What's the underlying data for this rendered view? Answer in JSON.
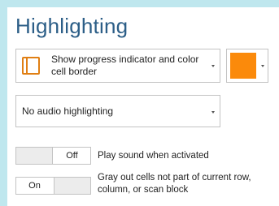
{
  "section": {
    "title": "Highlighting"
  },
  "indicator_dropdown": {
    "selected": "Show progress indicator and color cell border"
  },
  "color_picker": {
    "color": "#FB8A0B"
  },
  "audio_dropdown": {
    "selected": "No audio highlighting"
  },
  "toggles": [
    {
      "state": "Off",
      "label": "Play sound when activated"
    },
    {
      "state": "On",
      "label": "Gray out cells not part of current row, column, or scan block"
    }
  ]
}
